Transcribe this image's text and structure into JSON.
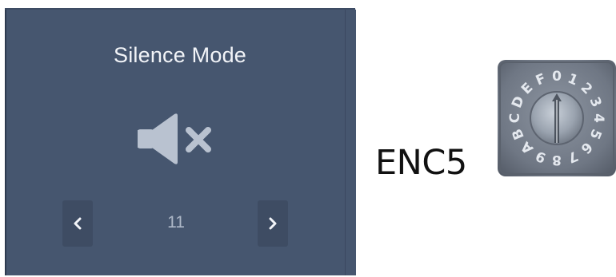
{
  "panel": {
    "title": "Silence Mode",
    "icon": "volume-mute-icon",
    "value": "11",
    "prev_icon": "chevron-left-icon",
    "next_icon": "chevron-right-icon",
    "colors": {
      "panel_bg": "#46566f",
      "button_bg": "#3e4c63",
      "icon": "#b9c2d0"
    }
  },
  "encoder": {
    "label": "ENC5",
    "dial_icon": "rotary-hex-switch-image",
    "dial_digits": [
      "0",
      "1",
      "2",
      "3",
      "4",
      "5",
      "6",
      "7",
      "8",
      "9",
      "A",
      "B",
      "C",
      "D",
      "E",
      "F"
    ]
  }
}
